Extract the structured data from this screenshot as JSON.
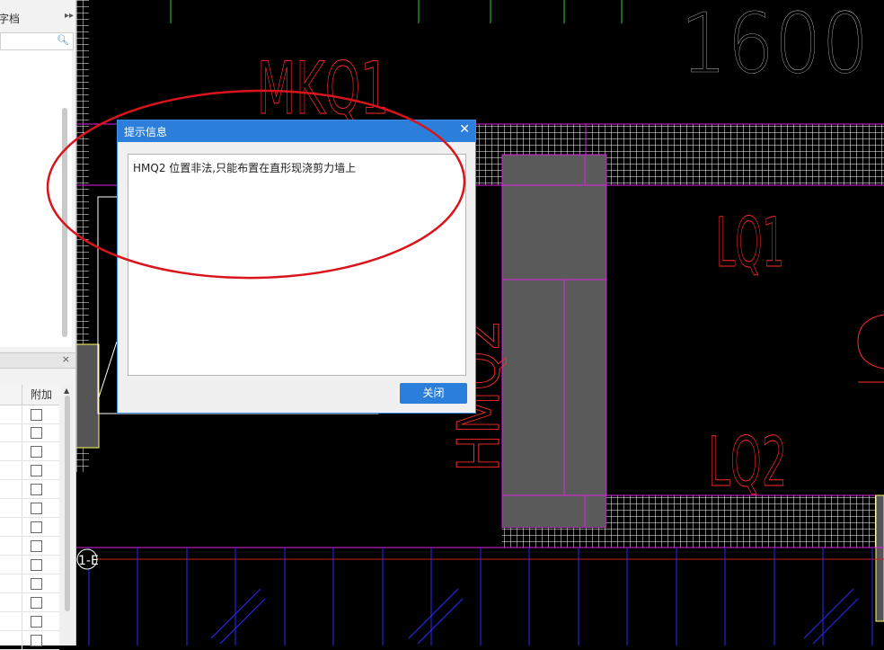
{
  "left_panel": {
    "header_title": "字档",
    "more_icon": "double-chevron-right-icon",
    "search_icon": "search-icon",
    "prop_column_header": "附加",
    "close_icon": "close-icon"
  },
  "cad": {
    "labels": {
      "dimension": "1600",
      "mkq1": "MKQ1",
      "lq1": "LQ1",
      "lq2": "LQ2",
      "hmq": "HMQ2",
      "axis": "1-E"
    }
  },
  "dialog": {
    "title": "提示信息",
    "message": "HMQ2 位置非法,只能布置在直形现浇剪力墙上",
    "close_label": "关闭"
  },
  "colors": {
    "dialog_blue": "#2b7fdb",
    "annotation_red": "#d9151b",
    "cad_red": "#ff2a2a",
    "cad_magenta": "#e020e0",
    "cad_blue": "#3a3aff"
  }
}
